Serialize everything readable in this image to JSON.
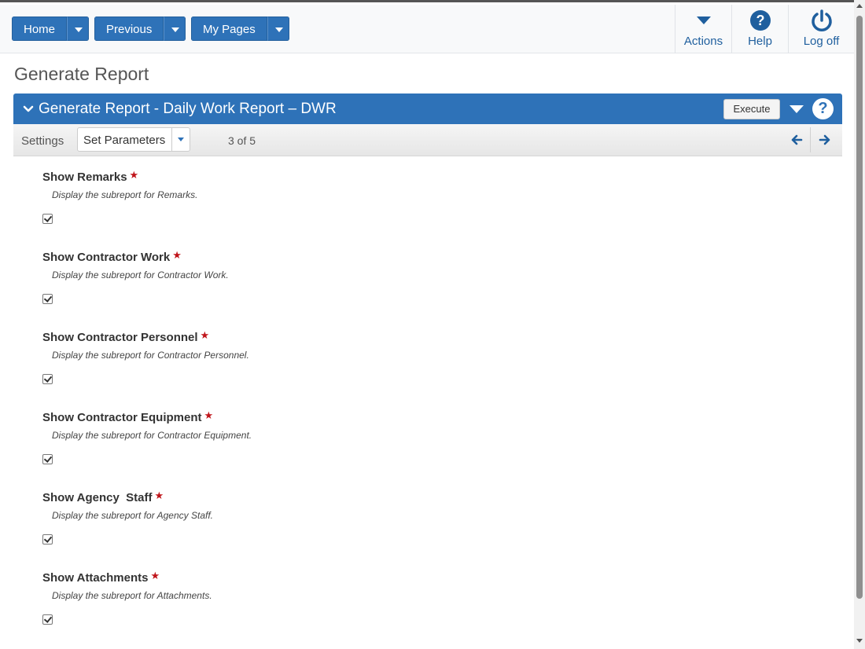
{
  "nav": {
    "home_label": "Home",
    "previous_label": "Previous",
    "mypages_label": "My Pages",
    "actions_label": "Actions",
    "help_label": "Help",
    "logoff_label": "Log off"
  },
  "page_title": "Generate Report",
  "panel": {
    "title": "Generate Report - Daily Work Report – DWR",
    "execute_label": "Execute"
  },
  "settings": {
    "label": "Settings",
    "selected": "Set Parameters",
    "pager": "3 of 5"
  },
  "params": [
    {
      "label": "Show Remarks",
      "required": "★",
      "description": "Display the subreport for Remarks.",
      "checked": true
    },
    {
      "label": "Show Contractor Work",
      "required": "★",
      "description": "Display the subreport for Contractor Work.",
      "checked": true
    },
    {
      "label": "Show Contractor Personnel",
      "required": "★",
      "description": "Display the subreport for Contractor Personnel.",
      "checked": true
    },
    {
      "label": "Show Contractor Equipment",
      "required": "★",
      "description": "Display the subreport for Contractor Equipment.",
      "checked": true
    },
    {
      "label": "Show Agency  Staff",
      "required": "★",
      "description": "Display the subreport for Agency Staff.",
      "checked": true
    },
    {
      "label": "Show Attachments",
      "required": "★",
      "description": "Display the subreport for Attachments.",
      "checked": true
    }
  ],
  "colors": {
    "primary": "#2e72b8",
    "required_star": "#c0141a",
    "nav_text": "#1f5f9e"
  }
}
